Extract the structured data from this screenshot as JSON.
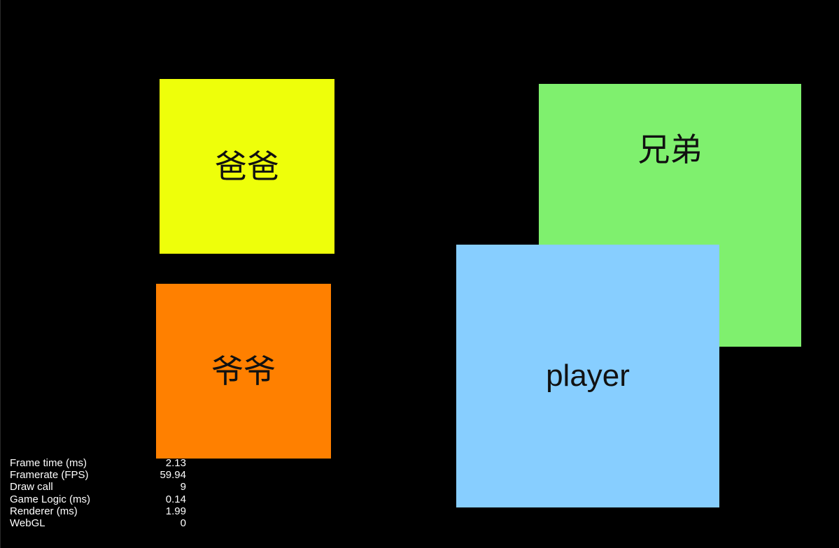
{
  "nodes": {
    "dad": {
      "label": "爸爸",
      "color": "#EEFF0A"
    },
    "grandpa": {
      "label": "爷爷",
      "color": "#FF8000"
    },
    "brother": {
      "label": "兄弟",
      "color": "#7FF06E"
    },
    "player": {
      "label": "player",
      "color": "#87CEFF"
    }
  },
  "stats": {
    "rows": [
      {
        "label": "Frame time (ms)",
        "value": "2.13"
      },
      {
        "label": "Framerate (FPS)",
        "value": "59.94"
      },
      {
        "label": "Draw call",
        "value": "9"
      },
      {
        "label": "Game Logic (ms)",
        "value": "0.14"
      },
      {
        "label": "Renderer (ms)",
        "value": "1.99"
      },
      {
        "label": "WebGL",
        "value": "0"
      }
    ]
  }
}
